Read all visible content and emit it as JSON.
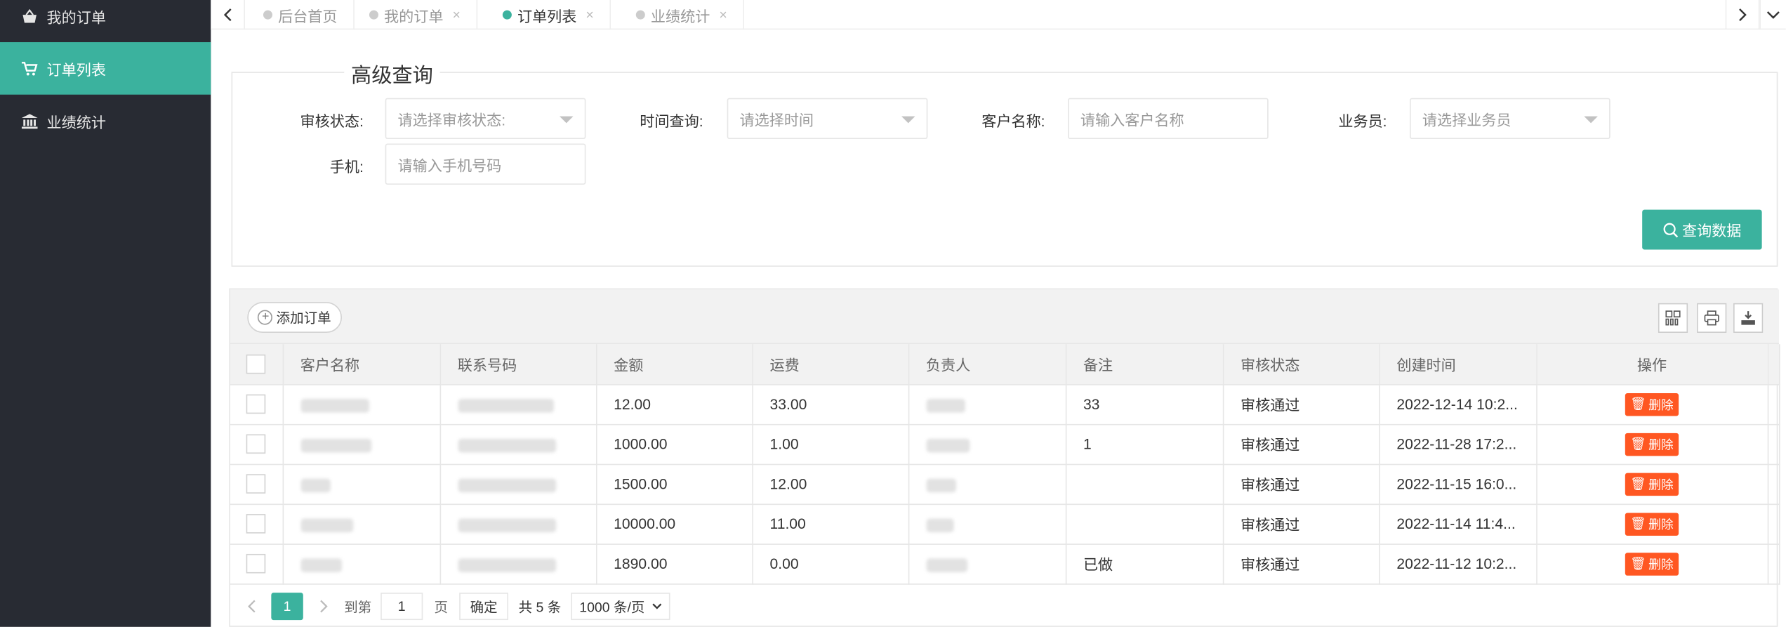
{
  "sidebar": {
    "items": [
      {
        "label": "我的订单",
        "icon": "basket-icon"
      },
      {
        "label": "订单列表",
        "icon": "cart-icon"
      },
      {
        "label": "业绩统计",
        "icon": "bank-icon"
      }
    ]
  },
  "tabs": [
    {
      "label": "后台首页"
    },
    {
      "label": "我的订单",
      "close": "×"
    },
    {
      "label": "订单列表",
      "close": "×"
    },
    {
      "label": "业绩统计",
      "close": "×"
    }
  ],
  "query": {
    "title": "高级查询",
    "audit_label": "审核状态:",
    "audit_placeholder": "请选择审核状态:",
    "time_label": "时间查询:",
    "time_placeholder": "请选择时间",
    "customer_label": "客户名称:",
    "customer_placeholder": "请输入客户名称",
    "sales_label": "业务员:",
    "sales_placeholder": "请选择业务员",
    "phone_label": "手机:",
    "phone_placeholder": "请输入手机号码",
    "search_label": "查询数据"
  },
  "toolbar": {
    "add_label": "添加订单"
  },
  "table": {
    "headers": [
      "客户名称",
      "联系号码",
      "金额",
      "运费",
      "负责人",
      "备注",
      "审核状态",
      "创建时间",
      "操作"
    ],
    "rows": [
      {
        "amount": "12.00",
        "freight": "33.00",
        "remark": "33",
        "status": "审核通过",
        "created": "2022-12-14 10:2..."
      },
      {
        "amount": "1000.00",
        "freight": "1.00",
        "remark": "1",
        "status": "审核通过",
        "created": "2022-11-28 17:2..."
      },
      {
        "amount": "1500.00",
        "freight": "12.00",
        "remark": "",
        "status": "审核通过",
        "created": "2022-11-15 16:0..."
      },
      {
        "amount": "10000.00",
        "freight": "11.00",
        "remark": "",
        "status": "审核通过",
        "created": "2022-11-14 11:4..."
      },
      {
        "amount": "1890.00",
        "freight": "0.00",
        "remark": "已做",
        "status": "审核通过",
        "created": "2022-11-12 10:2..."
      }
    ],
    "delete_label": "删除"
  },
  "pager": {
    "current": "1",
    "goto_label": "到第",
    "goto_value": "1",
    "page_unit": "页",
    "confirm_label": "确定",
    "total_label": "共 5 条",
    "size_label": "1000 条/页"
  }
}
